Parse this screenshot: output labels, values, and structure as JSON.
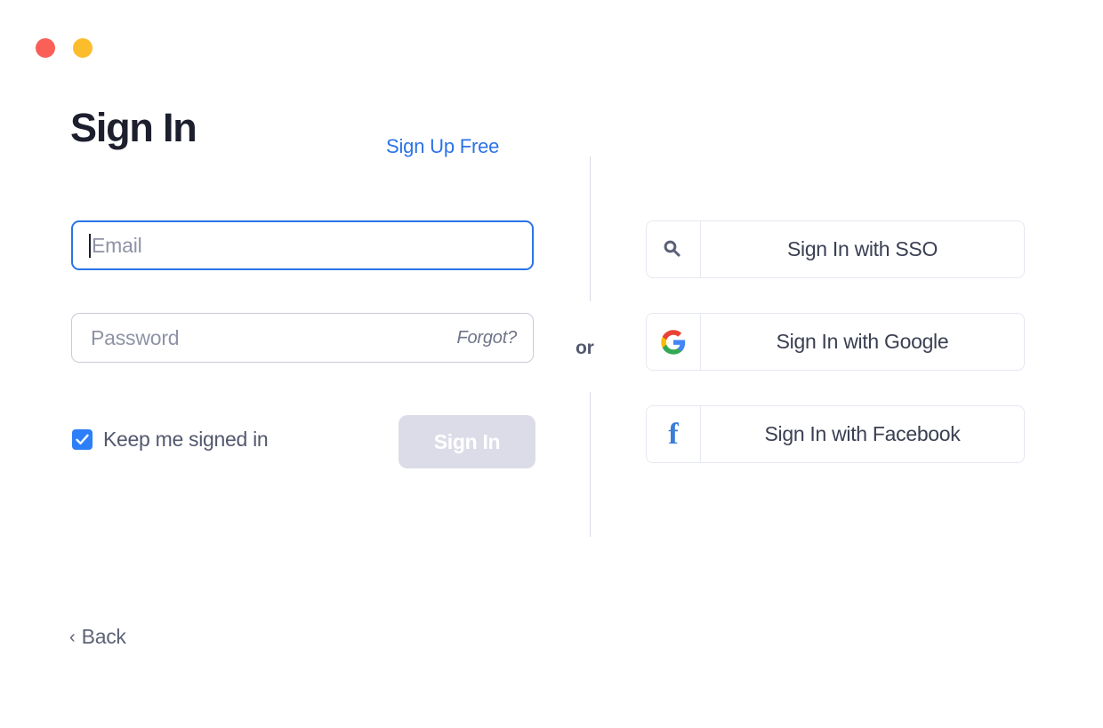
{
  "window": {
    "controls": [
      {
        "name": "close",
        "color": "#fa5f58"
      },
      {
        "name": "minimize",
        "color": "#fcbd2d"
      }
    ]
  },
  "header": {
    "title": "Sign In",
    "signup_link": "Sign Up Free",
    "signup_link_color": "#2b73e8"
  },
  "form": {
    "email": {
      "value": "",
      "placeholder": "Email",
      "focused": true,
      "border_color": "#2b73e8"
    },
    "password": {
      "value": "",
      "placeholder": "Password",
      "forgot_label": "Forgot?",
      "border_color": "#c9cbd8"
    },
    "keep_signed_in": {
      "label": "Keep me signed in",
      "checked": true,
      "checkbox_color": "#2d7ff9"
    },
    "submit": {
      "label": "Sign In",
      "disabled": true,
      "background": "#dcdce8",
      "text_color": "#ffffff"
    }
  },
  "divider": {
    "label": "or"
  },
  "alt_signin": {
    "buttons": [
      {
        "icon": "key-icon",
        "label": "Sign In with SSO"
      },
      {
        "icon": "google-icon",
        "label": "Sign In with Google"
      },
      {
        "icon": "facebook-icon",
        "label": "Sign In with Facebook",
        "glyph": "f"
      }
    ]
  },
  "footer": {
    "back_chevron": "‹",
    "back_label": "Back"
  }
}
